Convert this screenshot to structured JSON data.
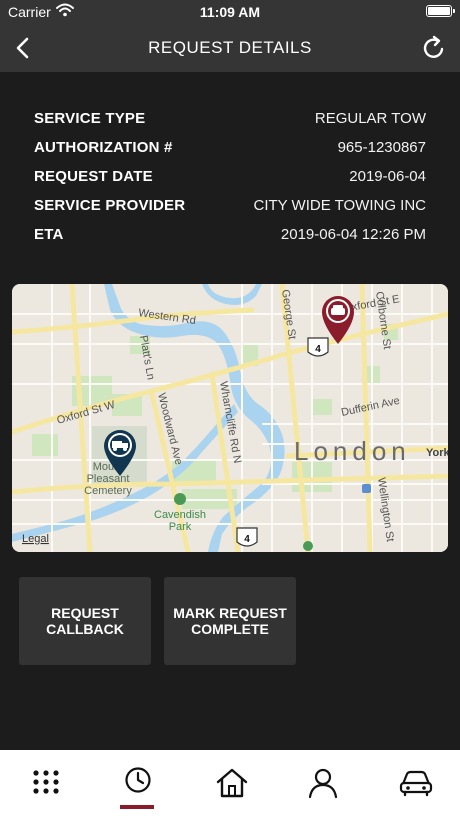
{
  "status_bar": {
    "carrier": "Carrier",
    "time": "11:09 AM"
  },
  "header": {
    "title": "REQUEST DETAILS",
    "back_icon": "chevron-left-icon",
    "refresh_icon": "refresh-icon"
  },
  "details": [
    {
      "label": "SERVICE TYPE",
      "value": "REGULAR TOW"
    },
    {
      "label": "AUTHORIZATION #",
      "value": "965-1230867"
    },
    {
      "label": "REQUEST DATE",
      "value": "2019-06-04"
    },
    {
      "label": "SERVICE PROVIDER",
      "value": "CITY WIDE TOWING INC"
    },
    {
      "label": "ETA",
      "value": "2019-06-04 12:26 PM"
    }
  ],
  "map": {
    "streets": [
      "Western Rd",
      "Platt's Ln",
      "Oxford St W",
      "Woodward Ave",
      "Wharncliffe Rd N",
      "George St",
      "Colborne St",
      "Dufferin Ave",
      "Wellington St",
      "Oxford St E"
    ],
    "city": "London",
    "york": "York",
    "cemetery_line1": "Mount",
    "cemetery_line2": "Pleasant",
    "cemetery_line3": "Cemetery",
    "park_line1": "Cavendish",
    "park_line2": "Park",
    "route_marker": "4",
    "legal": "Legal",
    "pin_vehicle_color": "#8a1c2b",
    "pin_tow_color": "#12364f"
  },
  "actions": {
    "callback": "REQUEST\nCALLBACK",
    "complete": "MARK REQUEST\nCOMPLETE"
  },
  "tabs": [
    {
      "name": "menu",
      "icon": "grid-icon"
    },
    {
      "name": "history",
      "icon": "clock-icon",
      "active": true
    },
    {
      "name": "home",
      "icon": "home-icon"
    },
    {
      "name": "profile",
      "icon": "user-icon"
    },
    {
      "name": "vehicle",
      "icon": "car-icon"
    }
  ],
  "colors": {
    "accent": "#8a1c2b",
    "bar": "#353535",
    "background": "#1c1c1c",
    "button": "#333333"
  }
}
